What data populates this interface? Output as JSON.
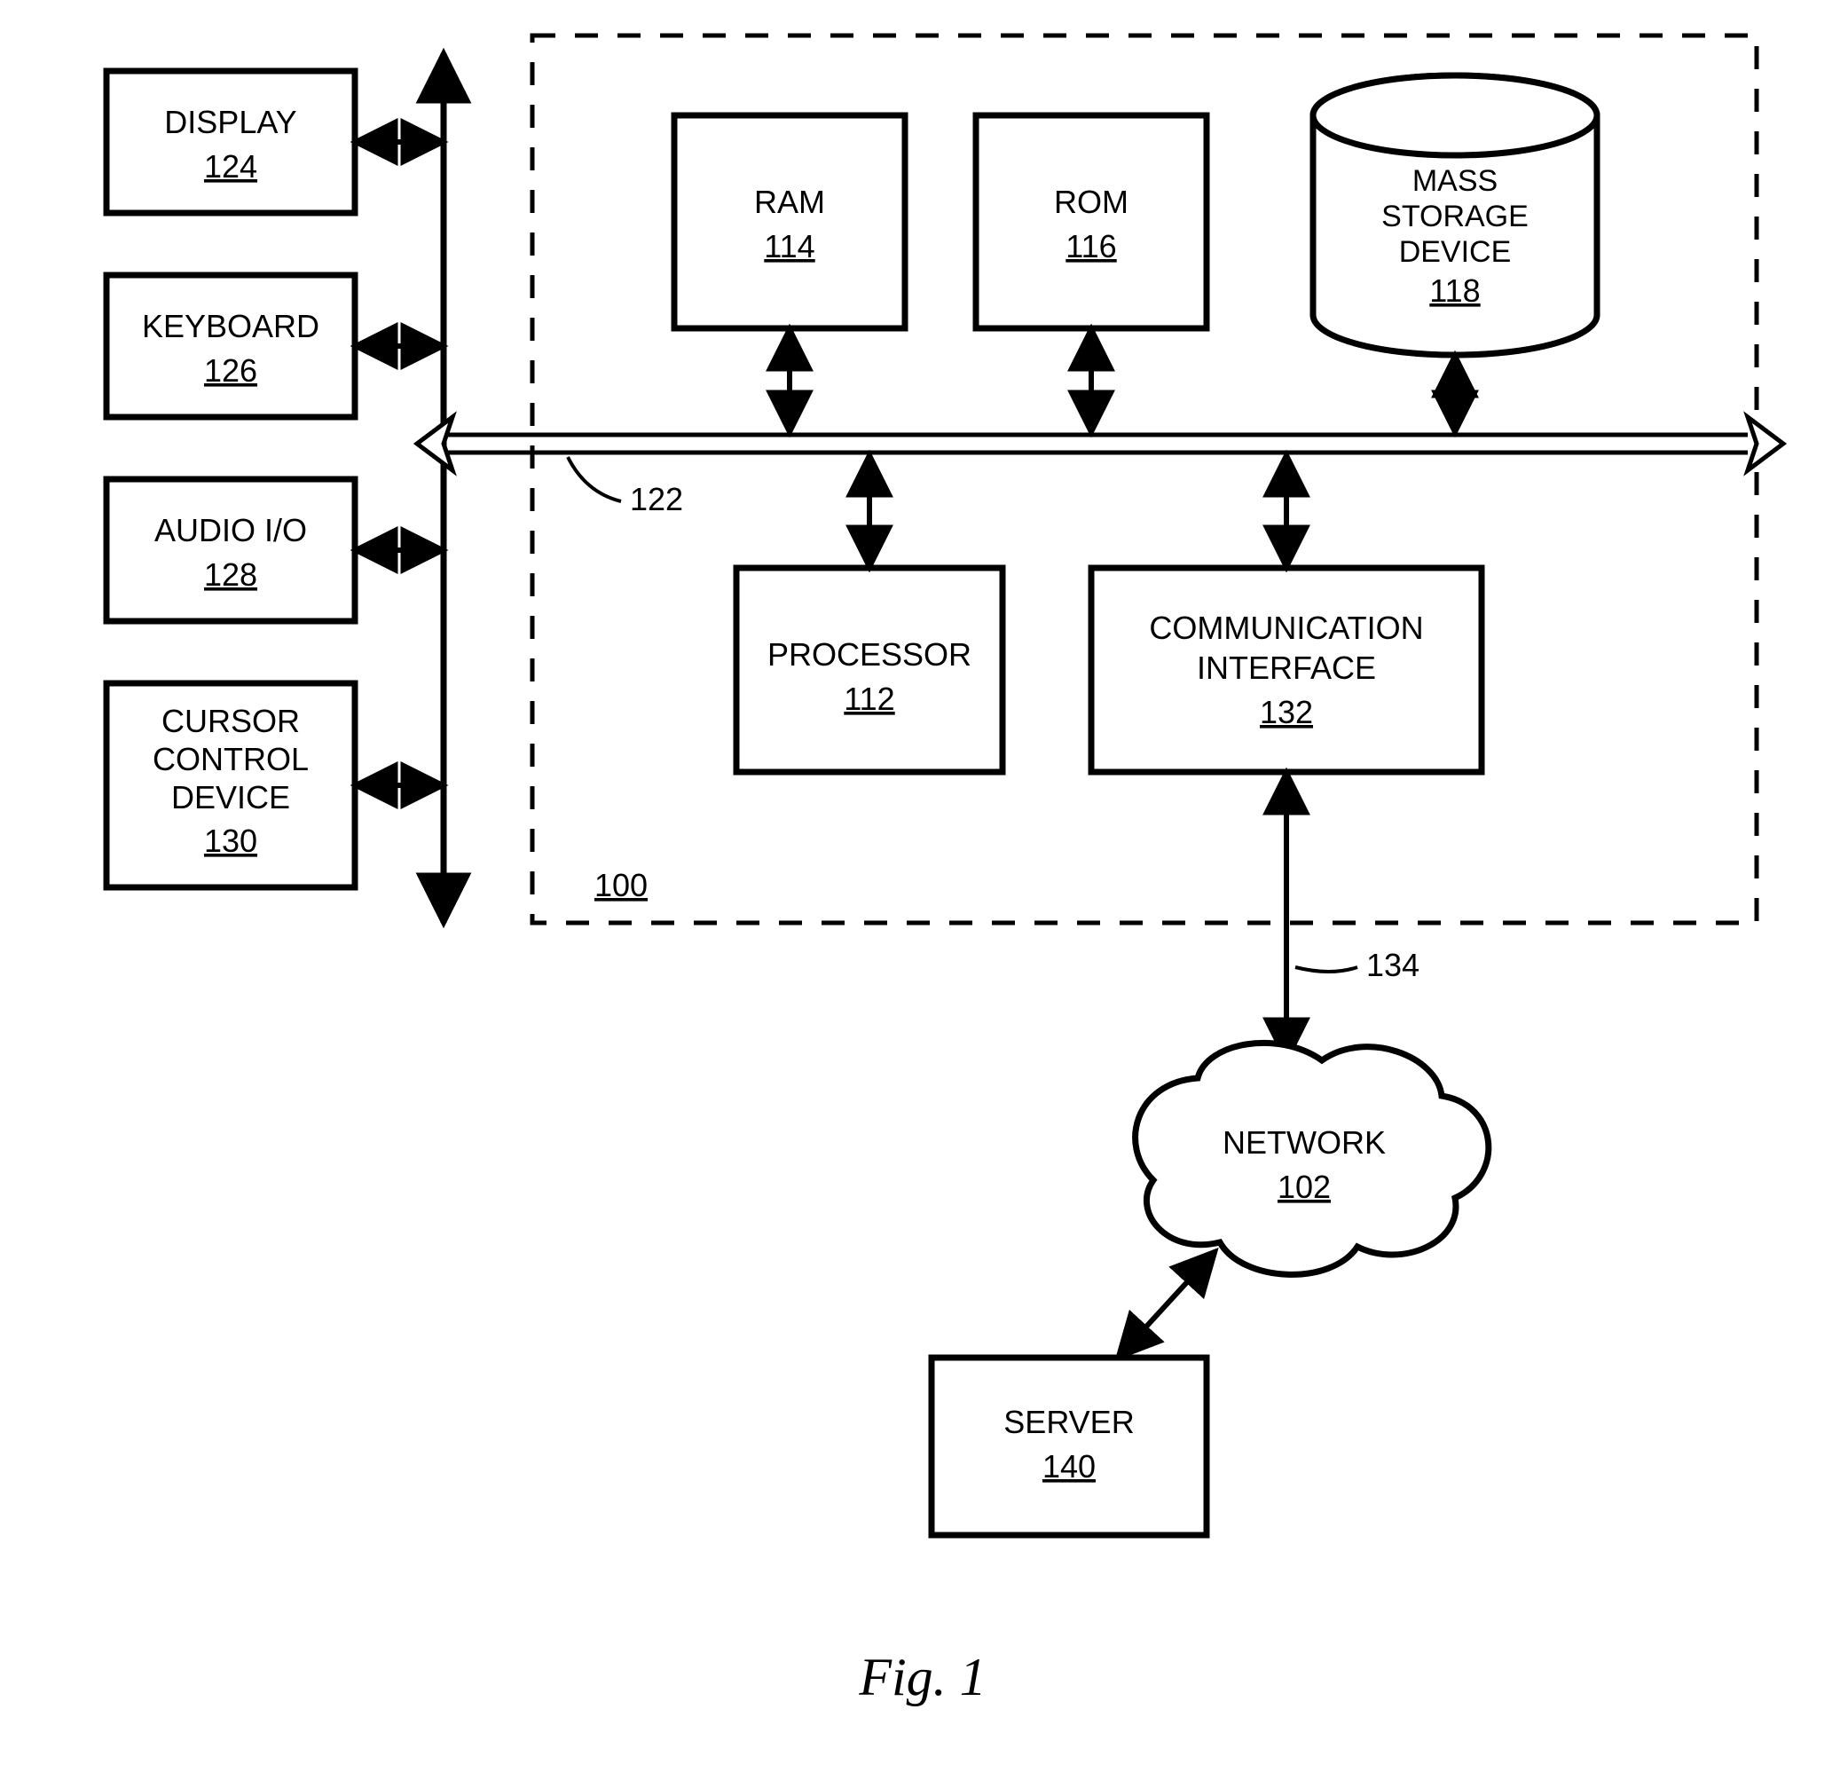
{
  "blocks": {
    "display": {
      "label": "DISPLAY",
      "num": "124"
    },
    "keyboard": {
      "label": "KEYBOARD",
      "num": "126"
    },
    "audio": {
      "label": "AUDIO I/O",
      "num": "128"
    },
    "cursor": {
      "l1": "CURSOR",
      "l2": "CONTROL",
      "l3": "DEVICE",
      "num": "130"
    },
    "ram": {
      "label": "RAM",
      "num": "114"
    },
    "rom": {
      "label": "ROM",
      "num": "116"
    },
    "storage": {
      "l1": "MASS",
      "l2": "STORAGE",
      "l3": "DEVICE",
      "num": "118"
    },
    "processor": {
      "label": "PROCESSOR",
      "num": "112"
    },
    "comm": {
      "l1": "COMMUNICATION",
      "l2": "INTERFACE",
      "num": "132"
    },
    "network": {
      "label": "NETWORK",
      "num": "102"
    },
    "server": {
      "label": "SERVER",
      "num": "140"
    }
  },
  "labels": {
    "bus_peripheral": "",
    "bus_internal": "122",
    "link": "134",
    "system": "100",
    "figure": "Fig. 1"
  }
}
